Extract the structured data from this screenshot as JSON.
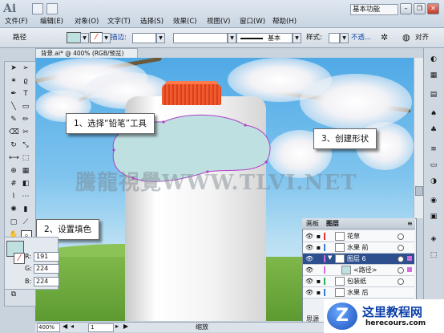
{
  "app": {
    "logo": "Ai",
    "workspace": "基本功能"
  },
  "window_controls": {
    "minimize": "–",
    "restore": "❐",
    "close": "✕"
  },
  "menu": [
    "文件(F)",
    "编辑(E)",
    "对象(O)",
    "文字(T)",
    "选择(S)",
    "效果(C)",
    "视图(V)",
    "窗口(W)",
    "帮助(H)"
  ],
  "control_bar": {
    "mode_label": "路径",
    "stroke_label": "描边:",
    "brush_label": "基本",
    "style_label": "样式:",
    "opacity_label": "不透...",
    "align_label": "对齐",
    "fill_color": "#bfe0e0"
  },
  "document": {
    "tab": "背景.ai* @ 400% (RGB/预览)",
    "zoom": "400%",
    "page": "1",
    "status": "缩放"
  },
  "watermark": "騰龍視覺WWW.TLVI.NET",
  "callouts": {
    "step1": "1、选择“铅笔”工具",
    "step2": "2、设置填色",
    "step3": "3、创建形状"
  },
  "color_panel": {
    "r_label": "R:",
    "r": "191",
    "g_label": "G:",
    "g": "224",
    "b_label": "B:",
    "b": "224"
  },
  "layers_panel": {
    "tabs": [
      "画板",
      "图层"
    ],
    "rows": [
      {
        "name": "花草",
        "selected": false
      },
      {
        "name": "水果 前",
        "selected": false
      },
      {
        "name": "图层 6",
        "selected": true
      },
      {
        "name": "<路径>",
        "selected": false
      },
      {
        "name": "包装纸",
        "selected": false
      },
      {
        "name": "水果 后",
        "selected": false
      }
    ],
    "footer": "思源"
  },
  "site_logo": {
    "letter": "Z",
    "name": "这里教程网",
    "url": "herecours.com"
  }
}
